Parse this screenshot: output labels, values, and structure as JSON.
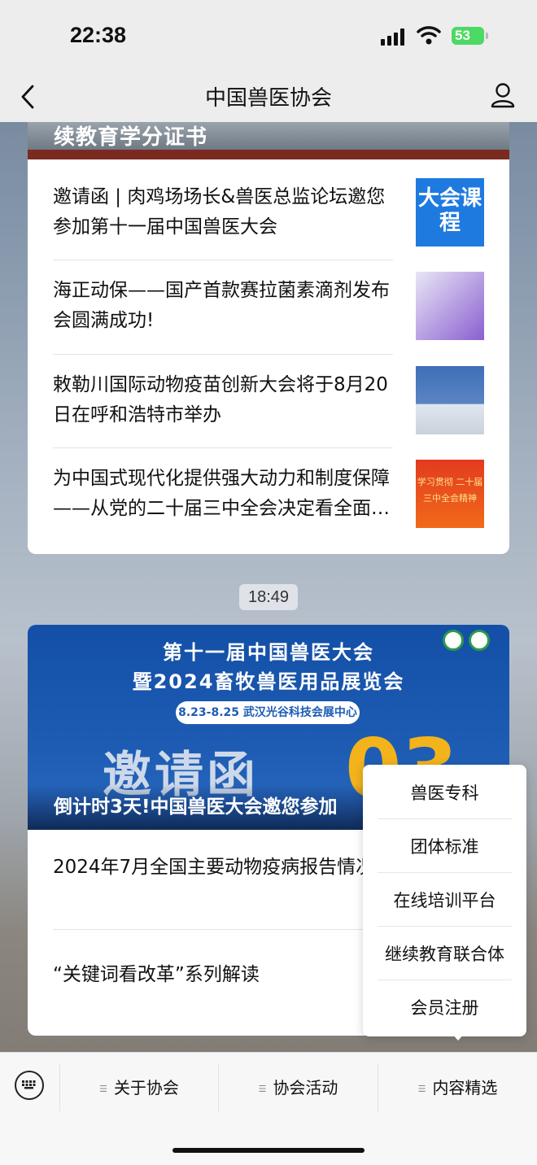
{
  "status": {
    "time": "22:38",
    "battery": "53"
  },
  "nav": {
    "title": "中国兽医协会"
  },
  "card1": {
    "banner_text": "续教育学分证书",
    "items": [
      {
        "title": "邀请函 | 肉鸡场场长&兽医总监论坛邀您参加第十一届中国兽医大会",
        "thumb_text": "大会课程"
      },
      {
        "title": "海正动保——国产首款赛拉菌素滴剂发布会圆满成功!"
      },
      {
        "title": "敕勒川国际动物疫苗创新大会将于8月20日在呼和浩特市举办"
      },
      {
        "title": "为中国式现代化提供强大动力和制度保障——从党的二十届三中全会决定看全面深化改革",
        "thumb_text": "学习贯彻 二十届三中全会精神"
      }
    ]
  },
  "timestamp": "18:49",
  "card2": {
    "banner": {
      "line1": "第十一届中国兽医大会",
      "line2": "暨2024畜牧兽医用品展览会",
      "pill": "8.23-8.25  武汉光谷科技会展中心",
      "big": "邀请函",
      "count": "03"
    },
    "caption": "倒计时3天!中国兽医大会邀您参加",
    "items": [
      {
        "title": "2024年7月全国主要动物疫病报告情况"
      },
      {
        "title": "“关键词看改革”系列解读"
      }
    ]
  },
  "menu": {
    "items": [
      "兽医专科",
      "团体标准",
      "在线培训平台",
      "继续教育联合体",
      "会员注册"
    ]
  },
  "tabs": [
    "关于协会",
    "协会活动",
    "内容精选"
  ],
  "icons": {
    "back": "chevron-left-icon",
    "profile": "person-icon",
    "keyboard": "keyboard-icon"
  },
  "colors": {
    "accent_blue": "#1e5cb4",
    "battery_green": "#4cd964"
  }
}
